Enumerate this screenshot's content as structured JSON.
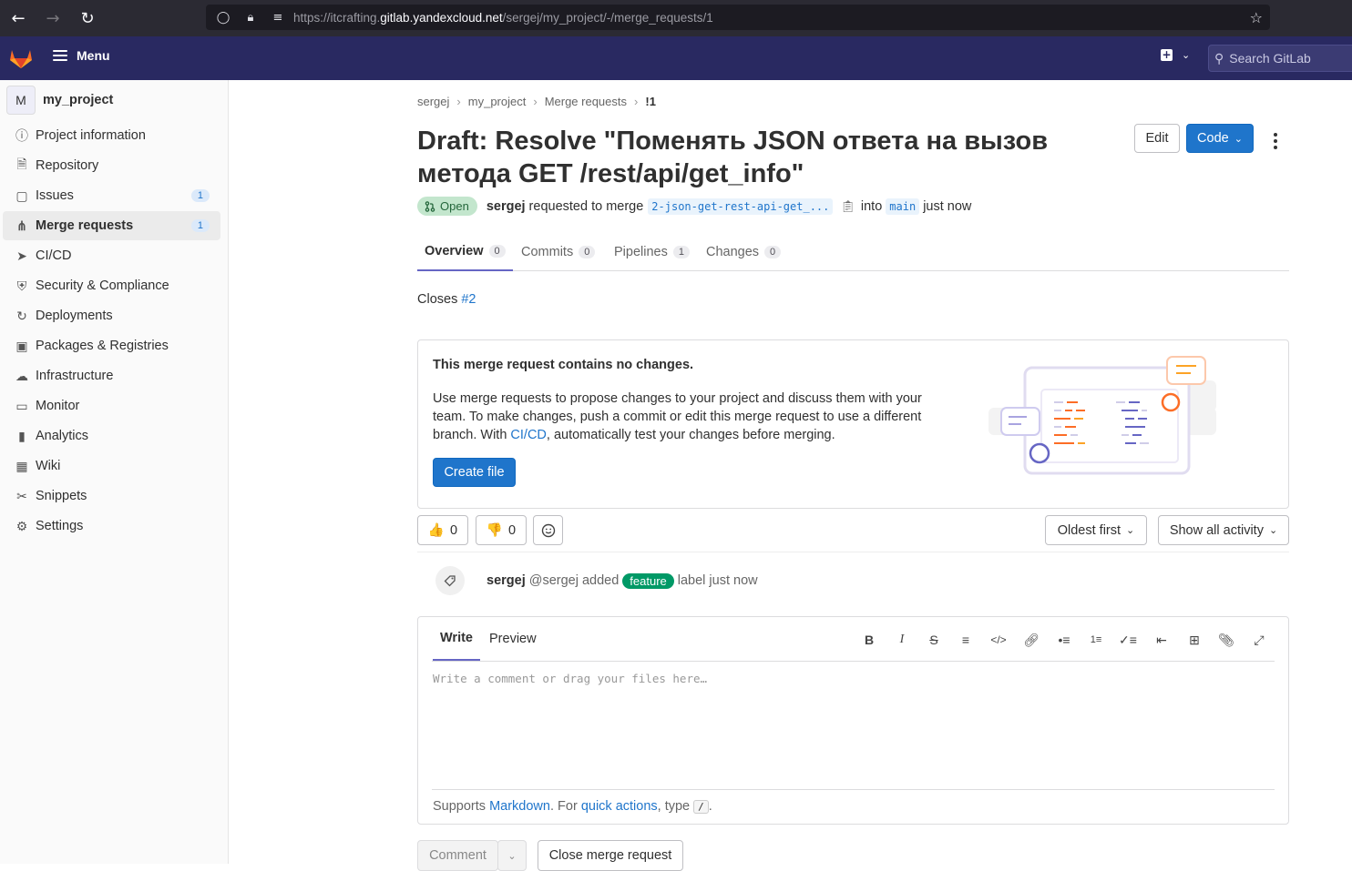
{
  "browser": {
    "url_prefix": "https://itcrafting.",
    "url_host": "gitlab.yandexcloud.net",
    "url_path": "/sergej/my_project/-/merge_requests/1"
  },
  "topbar": {
    "menu_label": "Menu",
    "search_placeholder": "Search GitLab"
  },
  "sidebar": {
    "project_avatar": "M",
    "project_name": "my_project",
    "items": [
      {
        "label": "Project information",
        "icon": "info-icon"
      },
      {
        "label": "Repository",
        "icon": "doc-icon"
      },
      {
        "label": "Issues",
        "icon": "issues-icon",
        "count": "1"
      },
      {
        "label": "Merge requests",
        "icon": "merge-request-icon",
        "count": "1",
        "active": true
      },
      {
        "label": "CI/CD",
        "icon": "rocket-icon"
      },
      {
        "label": "Security & Compliance",
        "icon": "shield-icon"
      },
      {
        "label": "Deployments",
        "icon": "deployments-icon"
      },
      {
        "label": "Packages & Registries",
        "icon": "package-icon"
      },
      {
        "label": "Infrastructure",
        "icon": "cloud-icon"
      },
      {
        "label": "Monitor",
        "icon": "monitor-icon"
      },
      {
        "label": "Analytics",
        "icon": "chart-icon"
      },
      {
        "label": "Wiki",
        "icon": "book-icon"
      },
      {
        "label": "Snippets",
        "icon": "scissors-icon"
      },
      {
        "label": "Settings",
        "icon": "gear-icon"
      }
    ]
  },
  "breadcrumbs": [
    "sergej",
    "my_project",
    "Merge requests",
    "!1"
  ],
  "mr": {
    "title": "Draft: Resolve \"Поменять JSON ответа на вызов метода GET /rest/api/get_info\"",
    "edit_label": "Edit",
    "code_label": "Code",
    "status": "Open",
    "author": "sergej",
    "requested_text": "requested to merge",
    "source_branch": "2-json-get-rest-api-get_...",
    "into_text": "into",
    "target_branch": "main",
    "time": "just now"
  },
  "tabs": [
    {
      "label": "Overview",
      "count": "0",
      "active": true
    },
    {
      "label": "Commits",
      "count": "0"
    },
    {
      "label": "Pipelines",
      "count": "1"
    },
    {
      "label": "Changes",
      "count": "0"
    }
  ],
  "description": {
    "closes_text": "Closes",
    "closes_link": "#2"
  },
  "empty_state": {
    "heading": "This merge request contains no changes.",
    "body_1": "Use merge requests to propose changes to your project and discuss them with your team. To make changes, push a commit or edit this merge request to use a different branch. With ",
    "body_link": "CI/CD",
    "body_2": ", automatically test your changes before merging.",
    "button": "Create file"
  },
  "reactions": {
    "thumbs_up": "0",
    "thumbs_down": "0",
    "sort_label": "Oldest first",
    "filter_label": "Show all activity"
  },
  "activity": {
    "author": "sergej",
    "handle": "@sergej",
    "added_text": "added",
    "label": "feature",
    "suffix": "label just now"
  },
  "editor": {
    "write_tab": "Write",
    "preview_tab": "Preview",
    "placeholder": "Write a comment or drag your files here…",
    "supports_text": "Supports",
    "markdown_link": "Markdown",
    "for_text": ". For",
    "quick_actions_link": "quick actions",
    "type_text": ", type",
    "kbd": "/",
    "end": "."
  },
  "footer_buttons": {
    "comment": "Comment",
    "close_mr": "Close merge request"
  },
  "colors": {
    "topbar": "#292961",
    "primary": "#1f75cb",
    "feature_label": "#009966"
  }
}
